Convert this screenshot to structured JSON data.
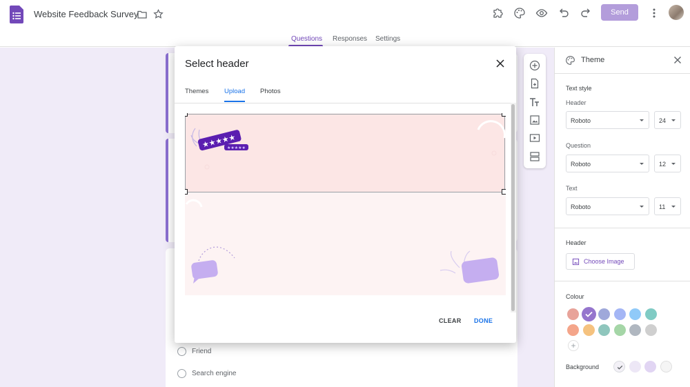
{
  "header": {
    "title": "Website Feedback Survey",
    "send_label": "Send"
  },
  "tabs": [
    {
      "label": "Questions",
      "active": true
    },
    {
      "label": "Responses",
      "active": false
    },
    {
      "label": "Settings",
      "active": false
    }
  ],
  "form": {
    "options": [
      "Friend",
      "Search engine"
    ]
  },
  "modal": {
    "title": "Select header",
    "tabs": [
      {
        "label": "Themes",
        "active": false
      },
      {
        "label": "Upload",
        "active": true
      },
      {
        "label": "Photos",
        "active": false
      }
    ],
    "clear_label": "CLEAR",
    "done_label": "DONE"
  },
  "theme": {
    "title": "Theme",
    "text_style_label": "Text style",
    "header_label": "Header",
    "header_font": "Roboto",
    "header_size": "24",
    "question_label": "Question",
    "question_font": "Roboto",
    "question_size": "12",
    "text_label": "Text",
    "text_font": "Roboto",
    "text_size": "11",
    "header_section_label": "Header",
    "choose_image_label": "Choose Image",
    "colour_label": "Colour",
    "background_label": "Background",
    "colours": [
      "#e8a39a",
      "#9575cd",
      "#9fa8da",
      "#a4b6f5",
      "#90caf9",
      "#80cbc4",
      "#f4a58a",
      "#f5c27f",
      "#8fc6bd",
      "#a5d6a7",
      "#b0b7c0",
      "#cfcfcf"
    ],
    "selected_colour": "#9575cd",
    "backgrounds": [
      "#f3f1f7",
      "#ede7f6",
      "#e1d5f3",
      "#f5f5f5"
    ]
  },
  "colors": {
    "accent": "#7248b9",
    "link_blue": "#1a73e8"
  }
}
